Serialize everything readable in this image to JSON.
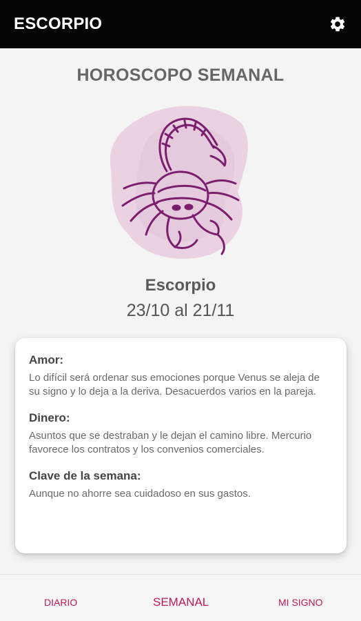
{
  "app_bar": {
    "title": "ESCORPIO",
    "settings_icon": "gear-icon"
  },
  "heading": "HOROSCOPO SEMANAL",
  "sign": {
    "name": "Escorpio",
    "dates": "23/10 al 21/11",
    "illustration_icon": "scorpion-icon"
  },
  "sections": [
    {
      "title": "Amor:",
      "text": "Lo difícil será ordenar sus emociones porque Venus se aleja de su signo y lo deja a la deriva. Desacuerdos varios en la pareja."
    },
    {
      "title": "Dinero:",
      "text": "Asuntos que se destraban y le dejan el camino libre. Mercurio favorece los contratos y los convenios comerciales."
    },
    {
      "title": "Clave de la semana:",
      "text": "Aunque no ahorre sea cuidadoso en sus gastos."
    }
  ],
  "bottom_nav": [
    {
      "label": "DIARIO"
    },
    {
      "label": "SEMANAL"
    },
    {
      "label": "MI SIGNO"
    }
  ],
  "colors": {
    "app_bar": "#050505",
    "accent": "#c2185b",
    "illustration": "#7b1e6e",
    "watercolor": "#d7a6c9"
  }
}
